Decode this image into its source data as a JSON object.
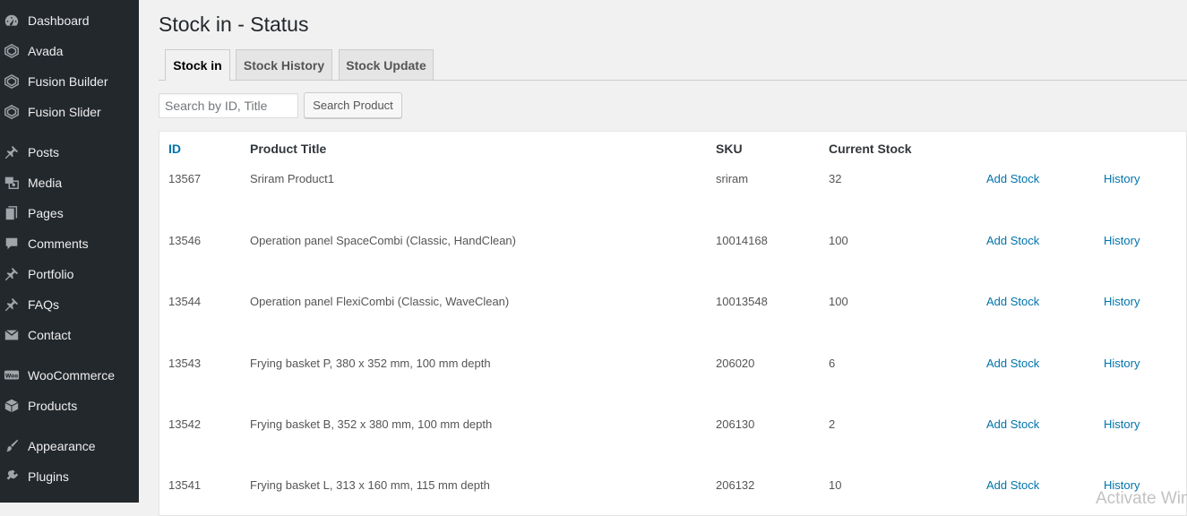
{
  "sidebar": {
    "items": [
      {
        "label": "Dashboard",
        "icon": "dashboard-icon"
      },
      {
        "label": "Avada",
        "icon": "avada-icon"
      },
      {
        "label": "Fusion Builder",
        "icon": "fusion-builder-icon"
      },
      {
        "label": "Fusion Slider",
        "icon": "fusion-slider-icon"
      },
      {
        "label": "Posts",
        "icon": "pin-icon"
      },
      {
        "label": "Media",
        "icon": "media-icon"
      },
      {
        "label": "Pages",
        "icon": "pages-icon"
      },
      {
        "label": "Comments",
        "icon": "comment-icon"
      },
      {
        "label": "Portfolio",
        "icon": "pin-icon"
      },
      {
        "label": "FAQs",
        "icon": "pin-icon"
      },
      {
        "label": "Contact",
        "icon": "envelope-icon"
      },
      {
        "label": "WooCommerce",
        "icon": "woocommerce-icon"
      },
      {
        "label": "Products",
        "icon": "box-icon"
      },
      {
        "label": "Appearance",
        "icon": "brush-icon"
      },
      {
        "label": "Plugins",
        "icon": "plug-icon"
      }
    ]
  },
  "page": {
    "title": "Stock in - Status"
  },
  "tabs": [
    {
      "label": "Stock in",
      "active": true
    },
    {
      "label": "Stock History",
      "active": false
    },
    {
      "label": "Stock Update",
      "active": false
    }
  ],
  "search": {
    "placeholder": "Search by ID, Title",
    "value": "",
    "button_label": "Search Product"
  },
  "table": {
    "headers": {
      "id": "ID",
      "title": "Product Title",
      "sku": "SKU",
      "stock": "Current Stock"
    },
    "rows": [
      {
        "id": "13567",
        "title": "Sriram Product1",
        "sku": "sriram",
        "stock": "32",
        "add": "Add Stock",
        "history": "History"
      },
      {
        "id": "13546",
        "title": "Operation panel SpaceCombi (Classic, HandClean)",
        "sku": "10014168",
        "stock": "100",
        "add": "Add Stock",
        "history": "History"
      },
      {
        "id": "13544",
        "title": "Operation panel FlexiCombi (Classic, WaveClean)",
        "sku": "10013548",
        "stock": "100",
        "add": "Add Stock",
        "history": "History"
      },
      {
        "id": "13543",
        "title": "Frying basket P, 380 x 352 mm, 100 mm depth",
        "sku": "206020",
        "stock": "6",
        "add": "Add Stock",
        "history": "History"
      },
      {
        "id": "13542",
        "title": "Frying basket B, 352 x 380 mm, 100 mm depth",
        "sku": "206130",
        "stock": "2",
        "add": "Add Stock",
        "history": "History"
      },
      {
        "id": "13541",
        "title": "Frying basket L, 313 x 160 mm, 115 mm depth",
        "sku": "206132",
        "stock": "10",
        "add": "Add Stock",
        "history": "History"
      }
    ]
  },
  "watermark": "Activate Windows",
  "colors": {
    "sidebar_bg": "#23282d",
    "link": "#0073aa",
    "page_bg": "#f1f1f1"
  }
}
